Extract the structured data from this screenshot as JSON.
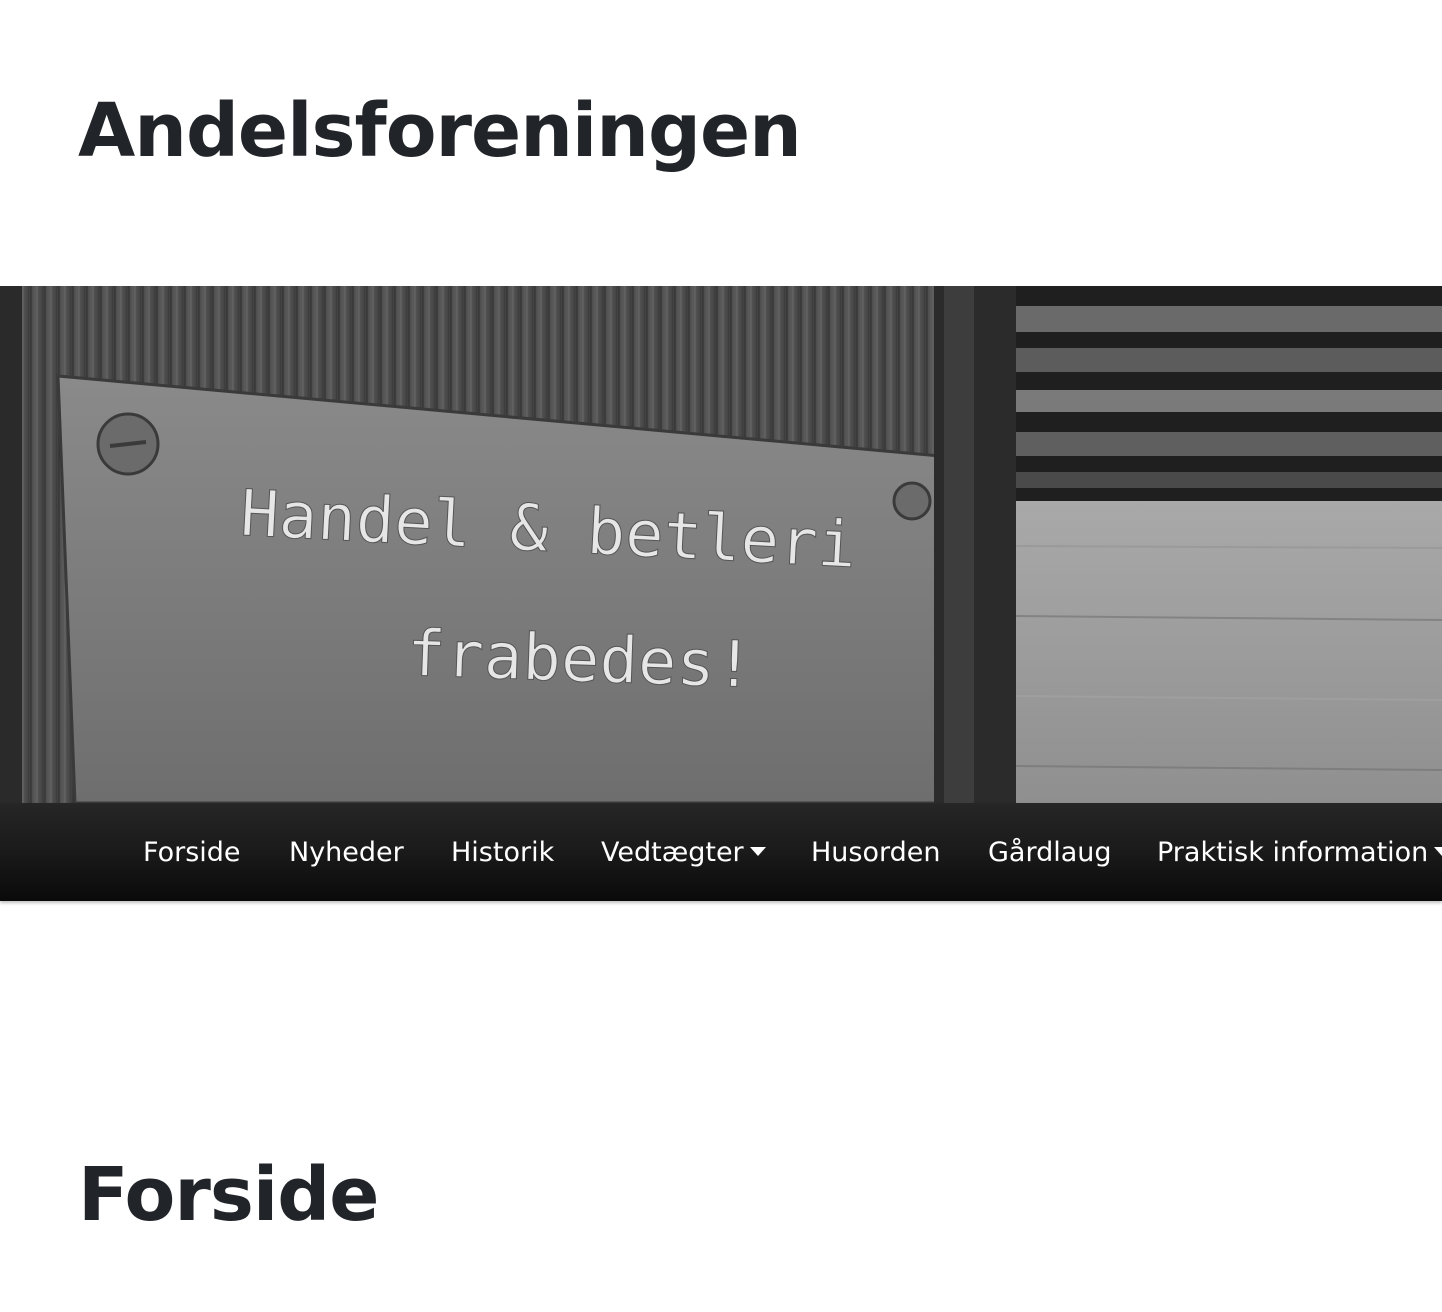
{
  "header": {
    "site_title": "Andelsforeningen"
  },
  "hero": {
    "sign_line1": "Handel & betleri",
    "sign_line2": "frabedes!"
  },
  "nav": {
    "items": [
      {
        "label": "Forside",
        "icon": null
      },
      {
        "label": "Nyheder",
        "icon": null
      },
      {
        "label": "Historik",
        "icon": null
      },
      {
        "label": "Vedtægter",
        "icon": "caret-down"
      },
      {
        "label": "Husorden",
        "icon": null
      },
      {
        "label": "Gårdlaug",
        "icon": null
      },
      {
        "label": "Praktisk information",
        "icon": "caret-down"
      }
    ]
  },
  "main": {
    "page_title": "Forside"
  },
  "colors": {
    "text": "#212529",
    "navbar": "#1a1a1a",
    "nav_text": "#ffffff"
  }
}
